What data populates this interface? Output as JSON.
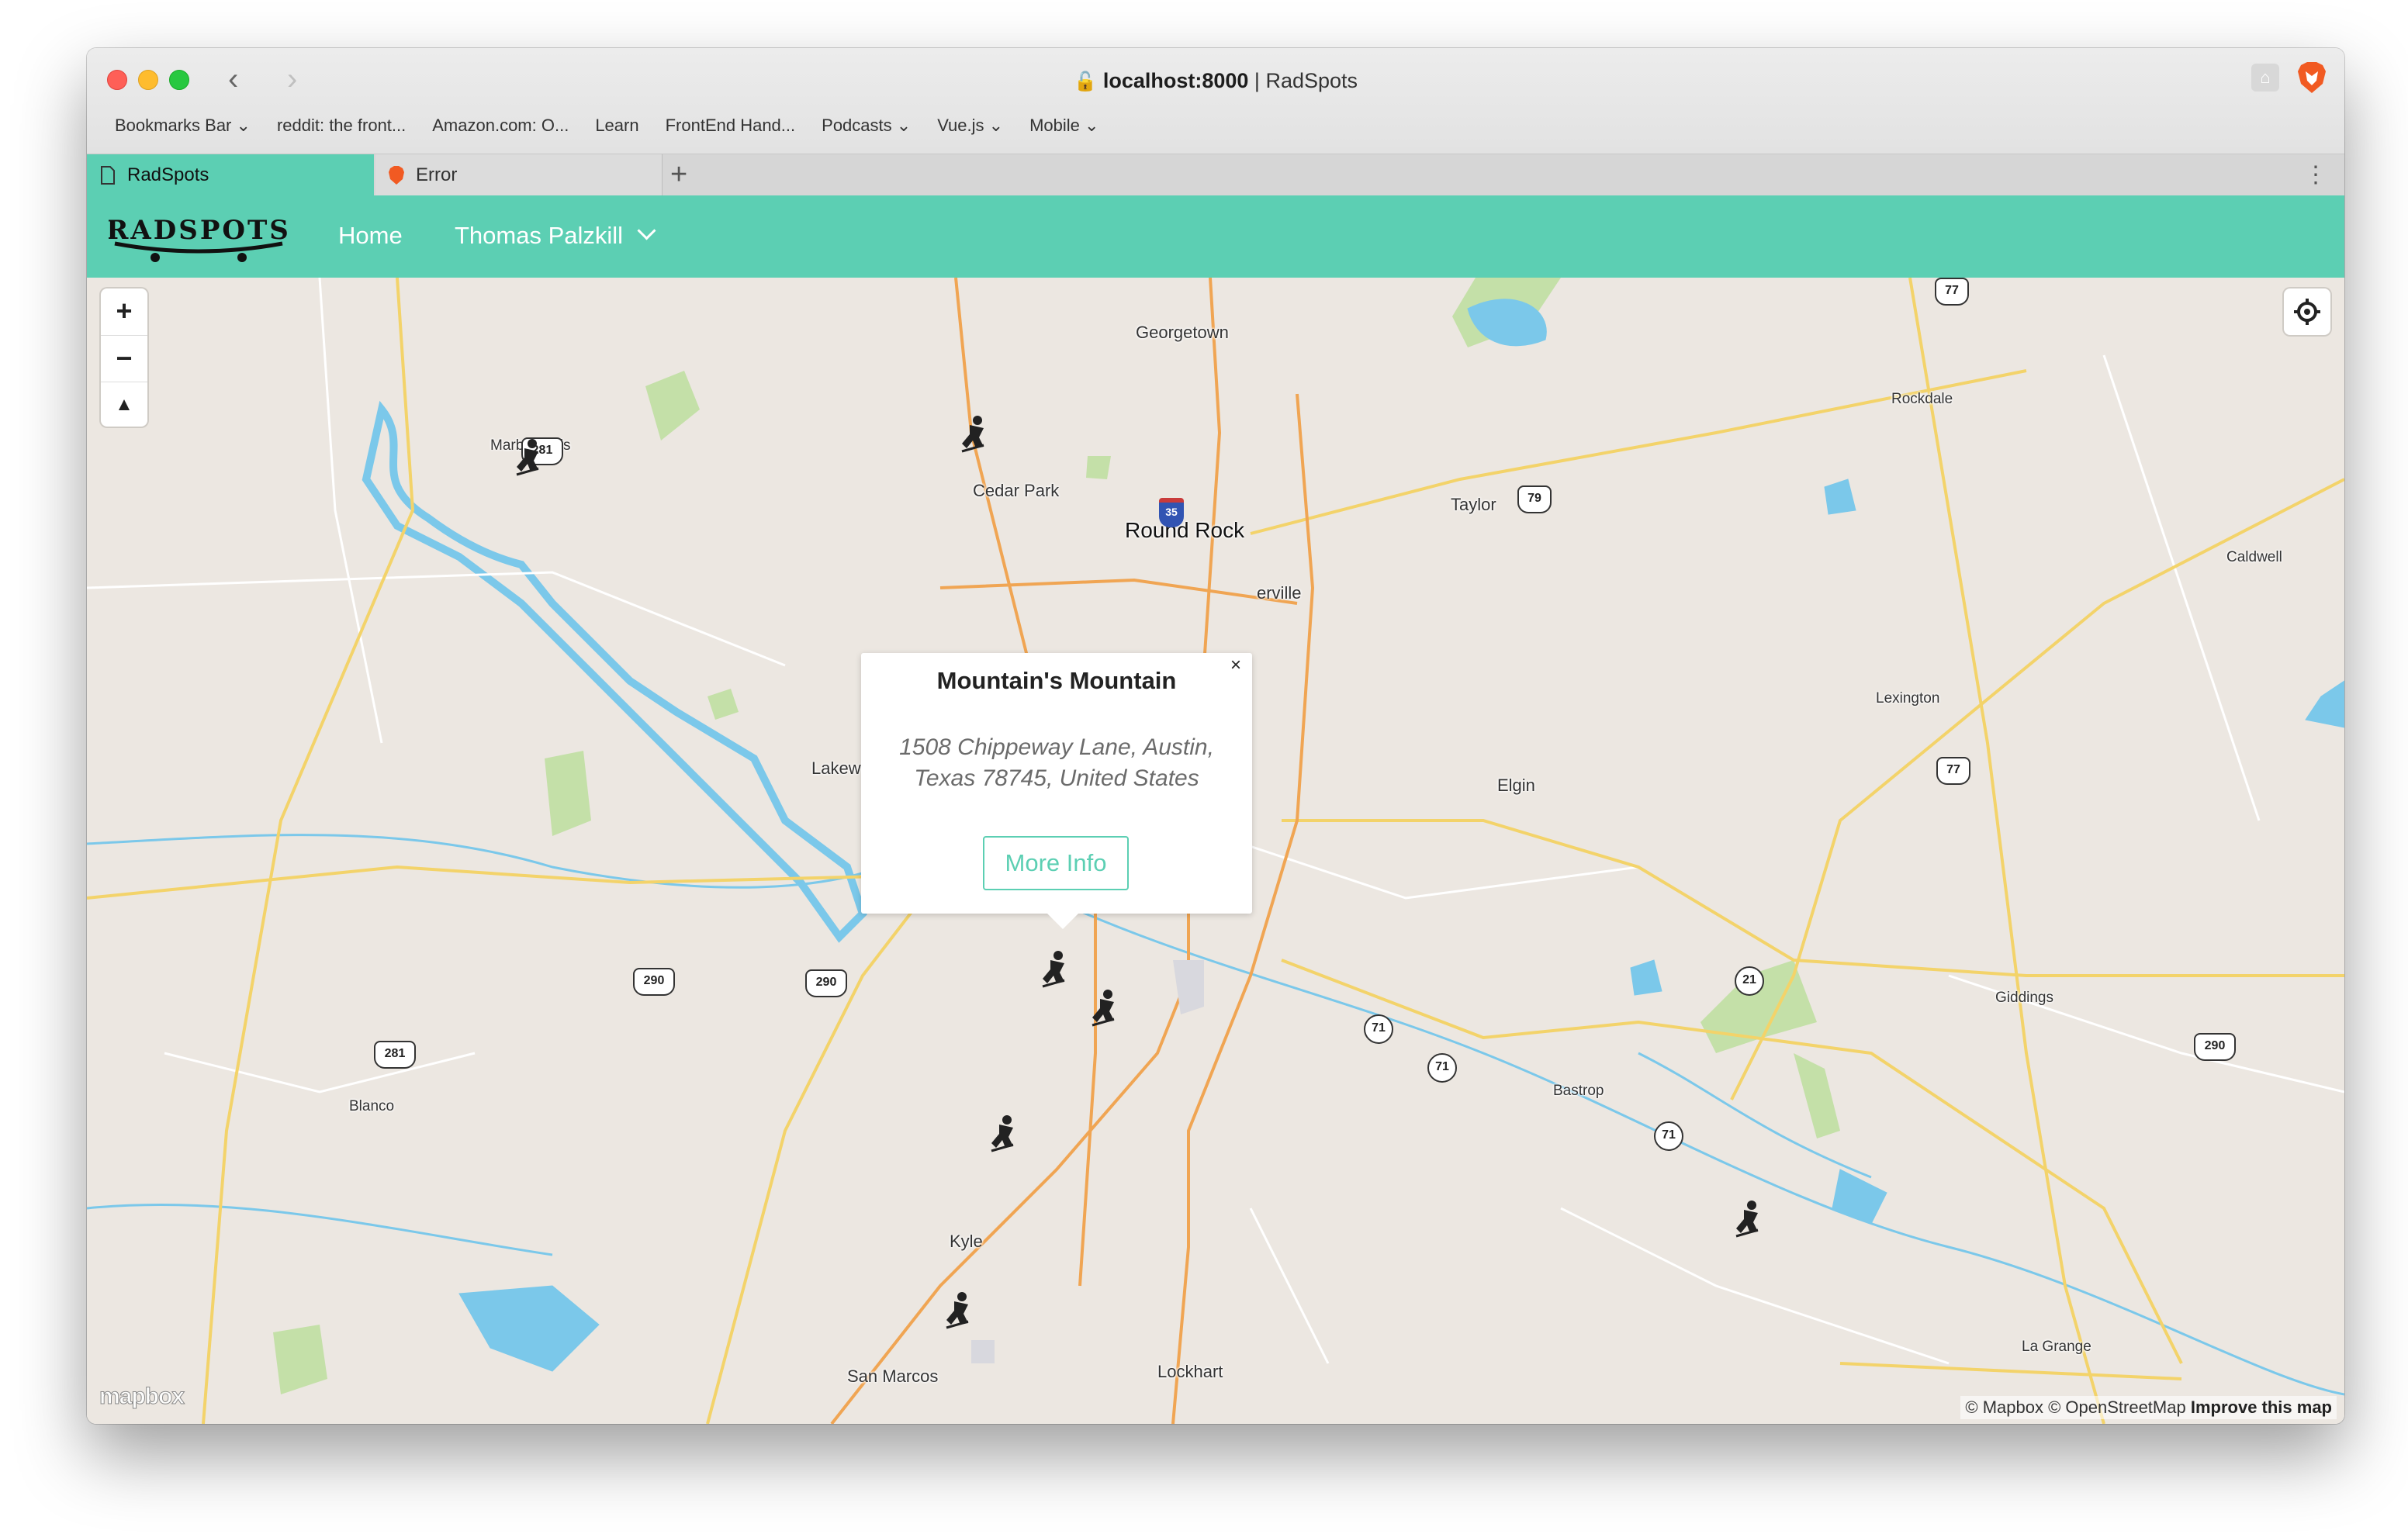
{
  "browser": {
    "host": "localhost:8000",
    "separator": " | ",
    "site_title": "RadSpots",
    "bookmarks": [
      "Bookmarks Bar ⌄",
      "reddit: the front...",
      "Amazon.com: O...",
      "Learn",
      "FrontEnd Hand...",
      "Podcasts ⌄",
      "Vue.js ⌄",
      "Mobile ⌄"
    ],
    "tabs": [
      {
        "label": "RadSpots"
      },
      {
        "label": "Error"
      }
    ],
    "new_tab": "+",
    "tab_menu": "⋮",
    "colors": {
      "tab_active": "#5ccfb3"
    }
  },
  "app": {
    "logo_text": "RADSPOTS",
    "nav": {
      "home": "Home",
      "user": "Thomas Palzkill"
    },
    "accent": "#5ccfb3"
  },
  "map": {
    "labels": {
      "georgetown": "Georgetown",
      "marble_falls": "Marble Falls",
      "cedar_park": "Cedar Park",
      "round_rock": "Round Rock",
      "pflugerville": "erville",
      "lakeway": "Lakew",
      "taylor": "Taylor",
      "rockdale": "Rockdale",
      "caldwell": "Caldwell",
      "lexington": "Lexington",
      "elgin": "Elgin",
      "giddings": "Giddings",
      "blanco": "Blanco",
      "bastrop": "Bastrop",
      "kyle": "Kyle",
      "san_marcos": "San Marcos",
      "lockhart": "Lockhart",
      "la_grange": "La Grange"
    },
    "shields": {
      "us281_north": "281",
      "us281_south": "281",
      "i35": "35",
      "us79": "79",
      "us77_north": "77",
      "us77_mid": "77",
      "us290_west": "290",
      "us290_mid": "290",
      "us290_east": "290",
      "sh71_a": "71",
      "sh71_b": "71",
      "sh71_c": "71",
      "sh21": "21"
    },
    "controls": {
      "zoom_in": "+",
      "zoom_out": "−",
      "compass": "▲"
    },
    "popup": {
      "close": "×",
      "title": "Mountain's Mountain",
      "address": "1508 Chippeway Lane, Austin, Texas 78745, United States",
      "button": "More Info"
    },
    "logo": "mapbox",
    "attribution": {
      "text": "© Mapbox © OpenStreetMap",
      "improve": "Improve this map"
    }
  }
}
